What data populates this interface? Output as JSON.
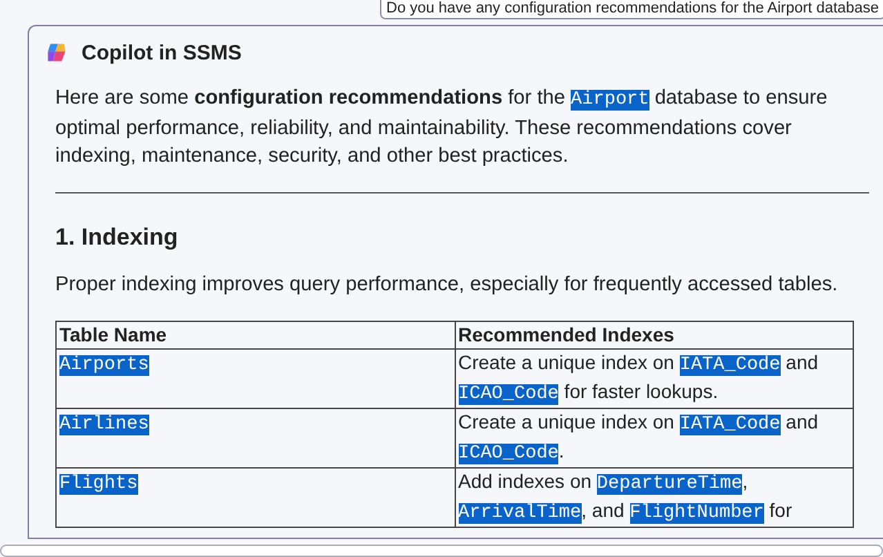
{
  "user_message": "Do you have any configuration recommendations for the Airport database",
  "response": {
    "title": "Copilot in SSMS",
    "intro": [
      {
        "kind": "plain",
        "text": "Here are some "
      },
      {
        "kind": "bold",
        "text": "configuration recommendations"
      },
      {
        "kind": "plain",
        "text": " for the "
      },
      {
        "kind": "code",
        "text": "Airport"
      },
      {
        "kind": "plain",
        "text": " database to ensure optimal performance, reliability, and maintainability. These recommendations cover indexing, maintenance, security, and other best practices."
      }
    ],
    "sections": [
      {
        "heading": "1. Indexing",
        "text": "Proper indexing improves query performance, especially for frequently accessed tables.",
        "table": {
          "columns": [
            "Table Name",
            "Recommended Indexes"
          ],
          "rows": [
            [
              [
                {
                  "kind": "code",
                  "text": "Airports"
                }
              ],
              [
                {
                  "kind": "plain",
                  "text": "Create a unique index on "
                },
                {
                  "kind": "code",
                  "text": "IATA_Code"
                },
                {
                  "kind": "plain",
                  "text": " and "
                },
                {
                  "kind": "code",
                  "text": "ICAO_Code"
                },
                {
                  "kind": "plain",
                  "text": " for faster lookups."
                }
              ]
            ],
            [
              [
                {
                  "kind": "code",
                  "text": "Airlines"
                }
              ],
              [
                {
                  "kind": "plain",
                  "text": "Create a unique index on "
                },
                {
                  "kind": "code",
                  "text": "IATA_Code"
                },
                {
                  "kind": "plain",
                  "text": " and "
                },
                {
                  "kind": "code",
                  "text": "ICAO_Code"
                },
                {
                  "kind": "plain",
                  "text": "."
                }
              ]
            ],
            [
              [
                {
                  "kind": "code",
                  "text": "Flights"
                }
              ],
              [
                {
                  "kind": "plain",
                  "text": "Add indexes on "
                },
                {
                  "kind": "code",
                  "text": "DepartureTime"
                },
                {
                  "kind": "plain",
                  "text": ", "
                },
                {
                  "kind": "code",
                  "text": "ArrivalTime"
                },
                {
                  "kind": "plain",
                  "text": ", and "
                },
                {
                  "kind": "code",
                  "text": "FlightNumber"
                },
                {
                  "kind": "plain",
                  "text": " for"
                }
              ]
            ]
          ]
        }
      }
    ]
  }
}
